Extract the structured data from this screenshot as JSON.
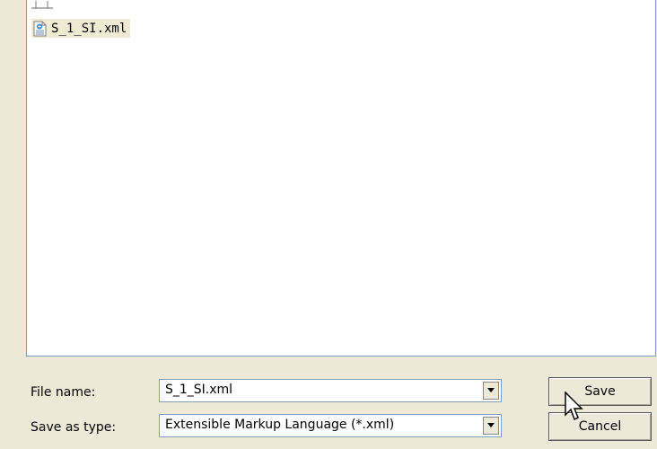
{
  "file_list": {
    "items": [
      {
        "name": "S_1_SI.xml",
        "icon": "xml-file-icon"
      }
    ]
  },
  "form": {
    "filename_label": "File name:",
    "filename_value": "S_1_SI.xml",
    "type_label": "Save as type:",
    "type_value": "Extensible Markup Language (*.xml)"
  },
  "buttons": {
    "save": "Save",
    "cancel": "Cancel"
  }
}
